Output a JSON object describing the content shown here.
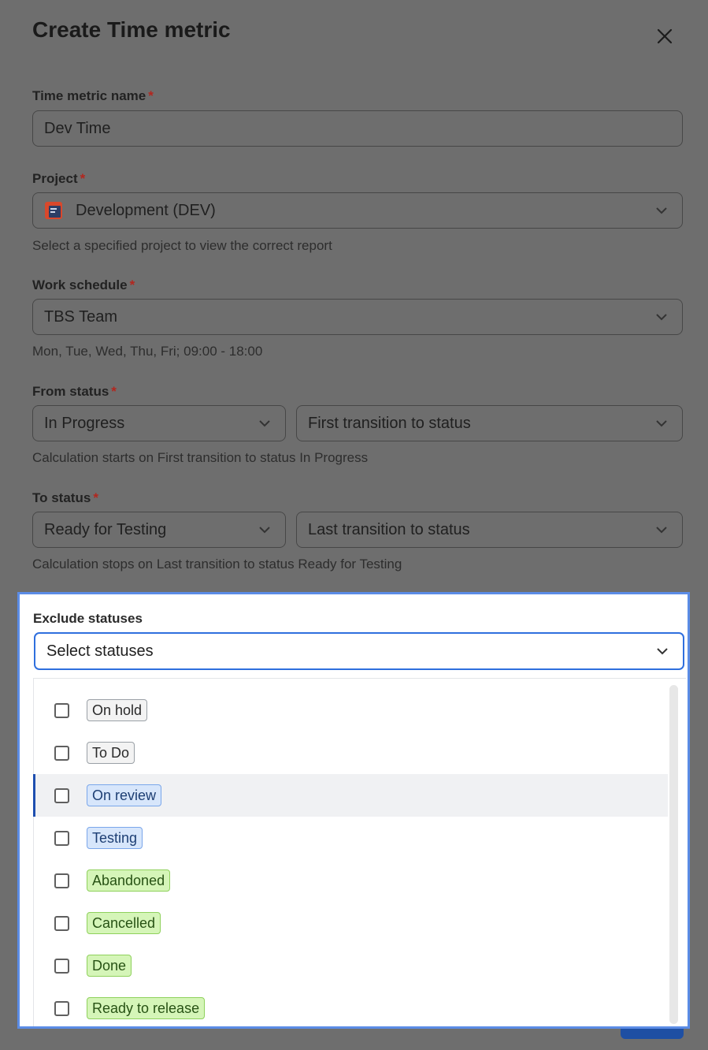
{
  "dialog": {
    "title": "Create Time metric"
  },
  "fields": {
    "name": {
      "label": "Time metric name",
      "value": "Dev Time"
    },
    "project": {
      "label": "Project",
      "value": "Development (DEV)",
      "hint": "Select a specified project to view the correct report"
    },
    "schedule": {
      "label": "Work schedule",
      "value": "TBS Team",
      "hint": "Mon, Tue, Wed, Thu, Fri; 09:00 - 18:00"
    },
    "from": {
      "label": "From status",
      "status": "In Progress",
      "transition": "First transition to status",
      "hint": "Calculation starts on First transition to status In Progress"
    },
    "to": {
      "label": "To status",
      "status": "Ready for Testing",
      "transition": "Last transition to status",
      "hint": "Calculation stops on Last transition to status Ready for Testing"
    },
    "required_mark": "*"
  },
  "exclude": {
    "label": "Exclude statuses",
    "placeholder": "Select statuses",
    "options": [
      {
        "label": "On hold",
        "color": "gray"
      },
      {
        "label": "To Do",
        "color": "gray"
      },
      {
        "label": "On review",
        "color": "blue"
      },
      {
        "label": "Testing",
        "color": "blue"
      },
      {
        "label": "Abandoned",
        "color": "green"
      },
      {
        "label": "Cancelled",
        "color": "green"
      },
      {
        "label": "Done",
        "color": "green"
      },
      {
        "label": "Ready to release",
        "color": "green"
      }
    ]
  },
  "colors": {
    "accent": "#2f6fde",
    "overlay": "#6e6e6e"
  }
}
